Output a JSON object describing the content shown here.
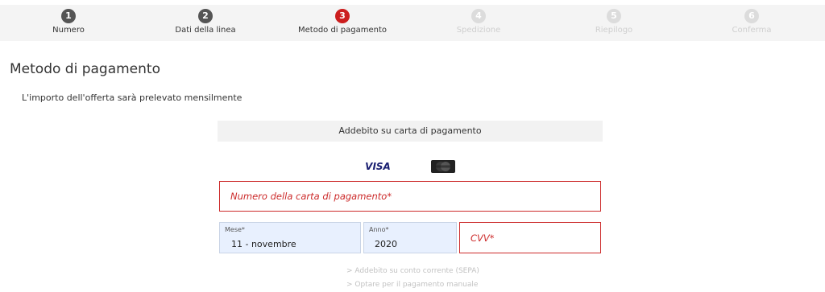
{
  "stepper": {
    "steps": [
      {
        "num": "1",
        "label": "Numero",
        "state": "done"
      },
      {
        "num": "2",
        "label": "Dati della linea",
        "state": "done"
      },
      {
        "num": "3",
        "label": "Metodo di pagamento",
        "state": "active"
      },
      {
        "num": "4",
        "label": "Spedizione",
        "state": "future"
      },
      {
        "num": "5",
        "label": "Riepilogo",
        "state": "future"
      },
      {
        "num": "6",
        "label": "Conferma",
        "state": "future"
      }
    ]
  },
  "page": {
    "title": "Metodo di pagamento",
    "subtitle": "L'importo dell'offerta sarà prelevato mensilmente"
  },
  "payment": {
    "header": "Addebito su carta di pagamento",
    "brands": [
      "VISA",
      "MasterCard"
    ],
    "card_number_placeholder": "Numero della carta di pagamento*",
    "month": {
      "label": "Mese*",
      "value": "11 - novembre"
    },
    "year": {
      "label": "Anno*",
      "value": "2020"
    },
    "cvv_placeholder": "CVV*"
  },
  "links": {
    "sepa": "> Addebito su conto corrente (SEPA)",
    "manual": "> Optare per il pagamento manuale"
  },
  "colors": {
    "accent": "#cc1e1e",
    "step_done": "#555555",
    "step_future": "#dcdcdc",
    "field_error": "#cc2a2a",
    "select_bg": "#e8f0fe"
  }
}
